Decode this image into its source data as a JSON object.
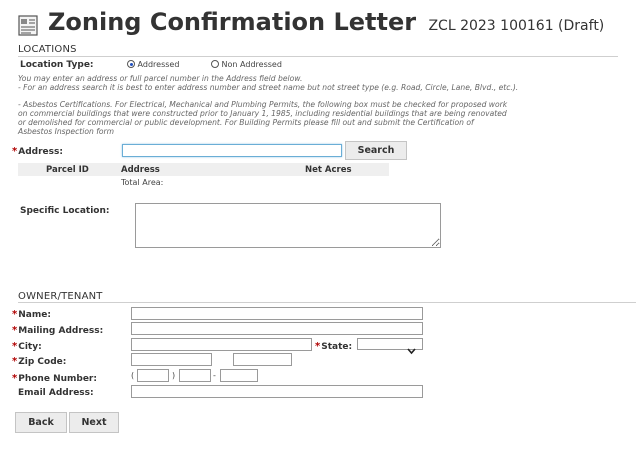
{
  "header": {
    "title": "Zoning Confirmation Letter",
    "record": "ZCL 2023 100161 (Draft)",
    "icon": "document-icon"
  },
  "locations": {
    "section_label": "LOCATIONS",
    "location_type_label": "Location Type:",
    "options": [
      {
        "label": "Addressed",
        "selected": true
      },
      {
        "label": "Non Addressed",
        "selected": false
      }
    ],
    "help_line_1": "You may enter an address or full parcel number in the Address field below.",
    "help_line_2": "- For an address search it is best to enter address number and street name but not street type (e.g. Road, Circle, Lane, Blvd., etc.).",
    "asbestos_1": "- Asbestos Certifications. For Electrical, Mechanical and Plumbing Permits, the following box must be checked for proposed work",
    "asbestos_2": "on commercial buildings that were constructed prior to January 1, 1985, including residential buildings that are being renovated",
    "asbestos_3": "or demolished for commercial or public development. For Building Permits please fill out and submit the Certification of",
    "asbestos_4": "Asbestos Inspection form",
    "address_label": "Address:",
    "address_value": "",
    "search_button": "Search",
    "table_headers": [
      "Parcel ID",
      "Address",
      "Net Acres"
    ],
    "total_area_label": "Total Area:",
    "specific_location_label": "Specific Location:",
    "specific_location_value": ""
  },
  "owner": {
    "section_label": "OWNER/TENANT",
    "name_label": "Name:",
    "mailing_label": "Mailing Address:",
    "city_label": "City:",
    "state_label": "State:",
    "zip_label": "Zip Code:",
    "phone_label": "Phone Number:",
    "email_label": "Email Address:",
    "name_value": "",
    "mailing_value": "",
    "city_value": "",
    "state_value": "",
    "zip_value": "",
    "zip_ext_value": "",
    "phone_area": "",
    "phone_prefix": "",
    "phone_line": "",
    "email_value": "",
    "phone_open": "(",
    "phone_close": ")",
    "phone_dash": "-"
  },
  "buttons": {
    "back": "Back",
    "next": "Next"
  },
  "colors": {
    "required": "#b00000",
    "focus": "#6aaed6",
    "radio_fill": "#2050c0"
  }
}
